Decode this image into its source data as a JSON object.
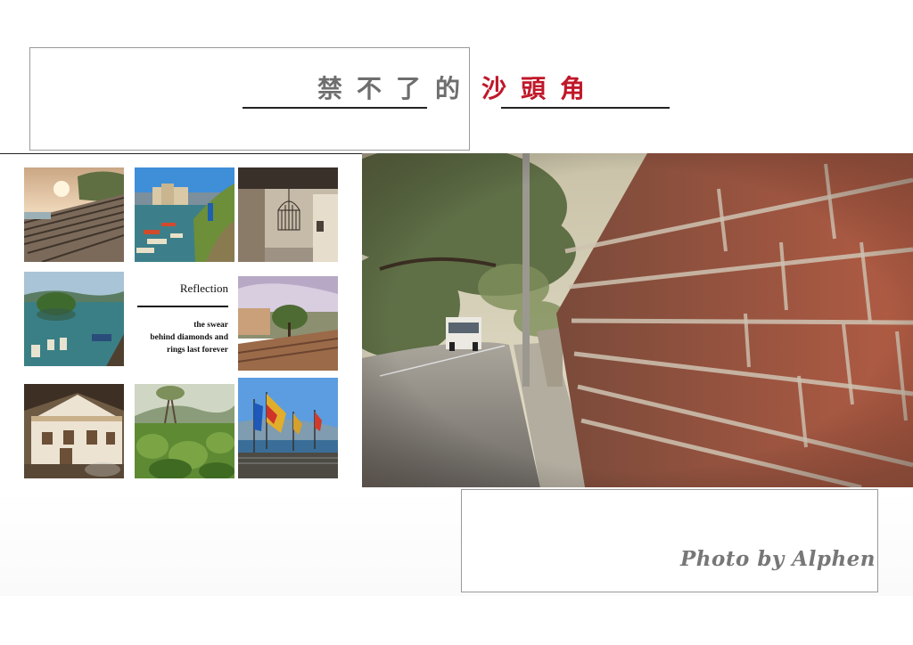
{
  "title": {
    "part1": "禁不了的",
    "part2": "沙頭角"
  },
  "reflection": {
    "heading": "Reflection",
    "lines": [
      "the swear",
      "behind diamonds and",
      "rings last forever"
    ]
  },
  "credit": "Photo by Alphen"
}
